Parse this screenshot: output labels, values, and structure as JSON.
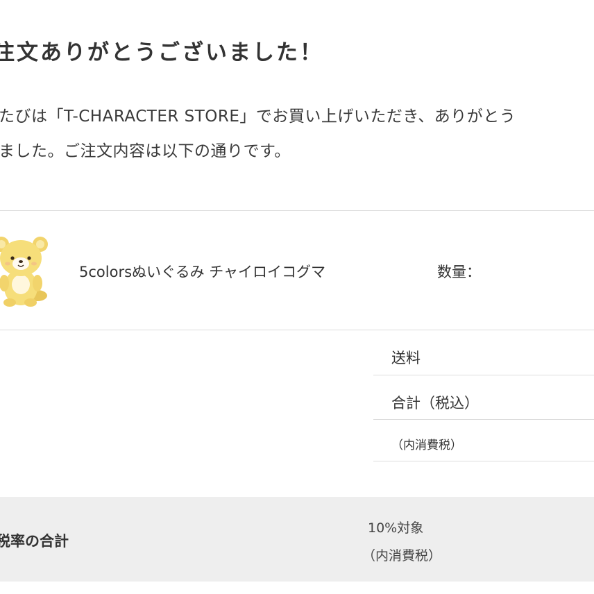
{
  "confirmation": {
    "heading": "注文ありがとうございました！",
    "message_line1": "たびは「T-CHARACTER STORE」でお買い上げいただき、ありがとう",
    "message_line2": "ました。ご注文内容は以下の通りです。"
  },
  "order_item": {
    "image_icon": "rilakkuma-plush-icon",
    "name": "5colorsぬいぐるみ チャイロイコグマ",
    "quantity_label": "数量："
  },
  "summary": {
    "shipping_label": "送料",
    "total_label": "合計（税込）",
    "tax_included_label": "（内消費税）"
  },
  "tax_breakdown": {
    "label": "税率の合計",
    "rate_label": "10%対象",
    "included_tax_label": "（内消費税）"
  },
  "colors": {
    "background": "#ffffff",
    "text": "#333333",
    "divider": "#dcdcdc",
    "band_background": "#eeeeee",
    "bear_body": "#f6de7a"
  }
}
